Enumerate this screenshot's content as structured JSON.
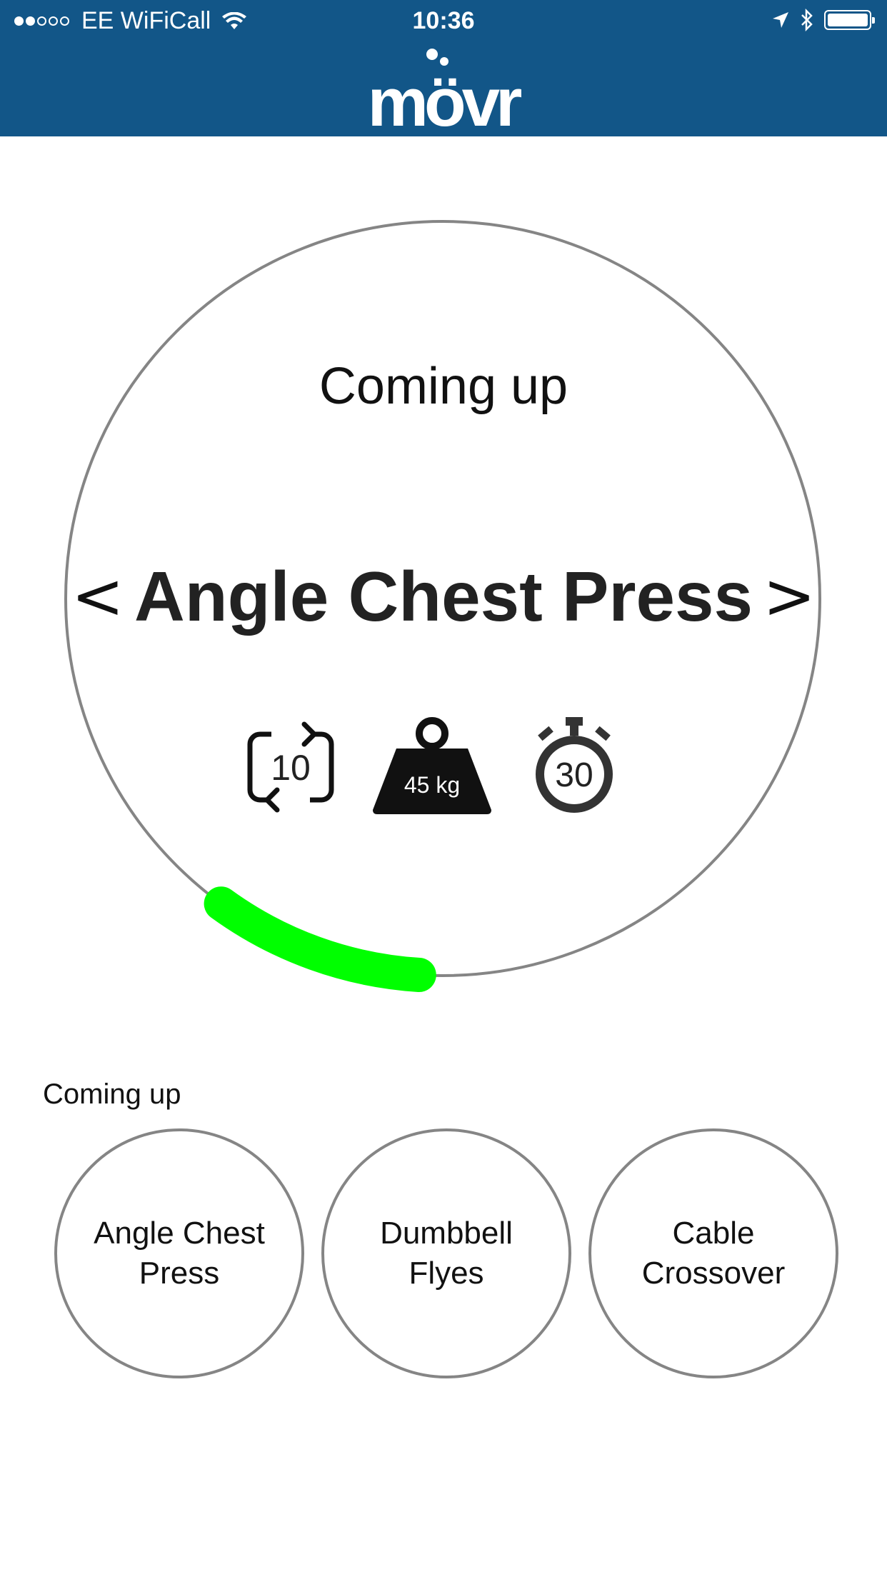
{
  "status_bar": {
    "carrier": "EE WiFiCall",
    "time": "10:36",
    "signal_dots_filled": 2,
    "signal_dots_total": 5
  },
  "header": {
    "logo_text": "mövr",
    "background_color": "#125688"
  },
  "workout": {
    "heading": "Coming up",
    "exercise_name": "Angle Chest Press",
    "prev_label": "<",
    "next_label": ">",
    "reps": "10",
    "weight": "45 kg",
    "timer": "30",
    "progress_fraction": 0.09,
    "progress_color": "#00ff00"
  },
  "up_next": {
    "label": "Coming up",
    "items": [
      {
        "line1": "Angle Chest",
        "line2": "Press"
      },
      {
        "line1": "Dumbbell",
        "line2": "Flyes"
      },
      {
        "line1": "Cable",
        "line2": "Crossover"
      }
    ]
  }
}
